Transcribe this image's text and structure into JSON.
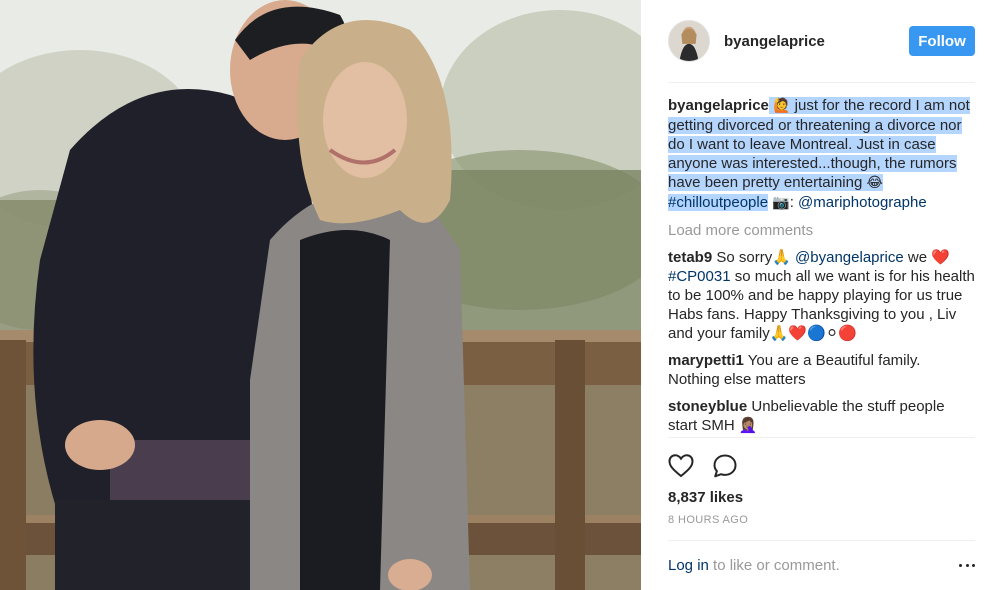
{
  "post": {
    "username": "byangelaprice",
    "follow_label": "Follow",
    "caption": {
      "username": "byangelaprice",
      "emoji_lead": "🙋",
      "text": " just for the record I am not getting divorced or threatening a divorce nor do I want to leave Montreal. Just in case anyone was interested...though, the rumors have been pretty entertaining ",
      "emoji_laugh": "😂",
      "hashtag": "#chilloutpeople",
      "camera_emoji": "📷",
      "credit_prefix": ": ",
      "credit_mention": "@mariphotographe"
    },
    "load_more_label": "Load more comments",
    "comments": [
      {
        "username": "tetab9",
        "parts": {
          "a": " So sorry🙏 ",
          "mention": "@byangelaprice",
          "b": " we ❤️ ",
          "hashtag": "#CP0031",
          "c": " so much all we want is for his health to be 100% and be happy playing for us true Habs fans. Happy Thanksgiving to you , Liv and your family🙏❤️🔵⚪🔴"
        }
      },
      {
        "username": "marypetti1",
        "text": " You are a Beautiful family. Nothing else matters"
      },
      {
        "username": "stoneyblue",
        "text": " Unbelievable the stuff people start SMH 🤦🏽‍♀️"
      }
    ],
    "likes": "8,837 likes",
    "time": "8 HOURS AGO",
    "footer": {
      "login_label": "Log in",
      "rest": " to like or comment."
    }
  },
  "icons": {
    "like": "heart-outline-icon",
    "comment": "speech-bubble-icon",
    "more": "more-options-icon"
  },
  "colors": {
    "follow_button": "#3897f0",
    "link": "#003569",
    "muted": "#999999",
    "selection": "#b4d5fe"
  }
}
